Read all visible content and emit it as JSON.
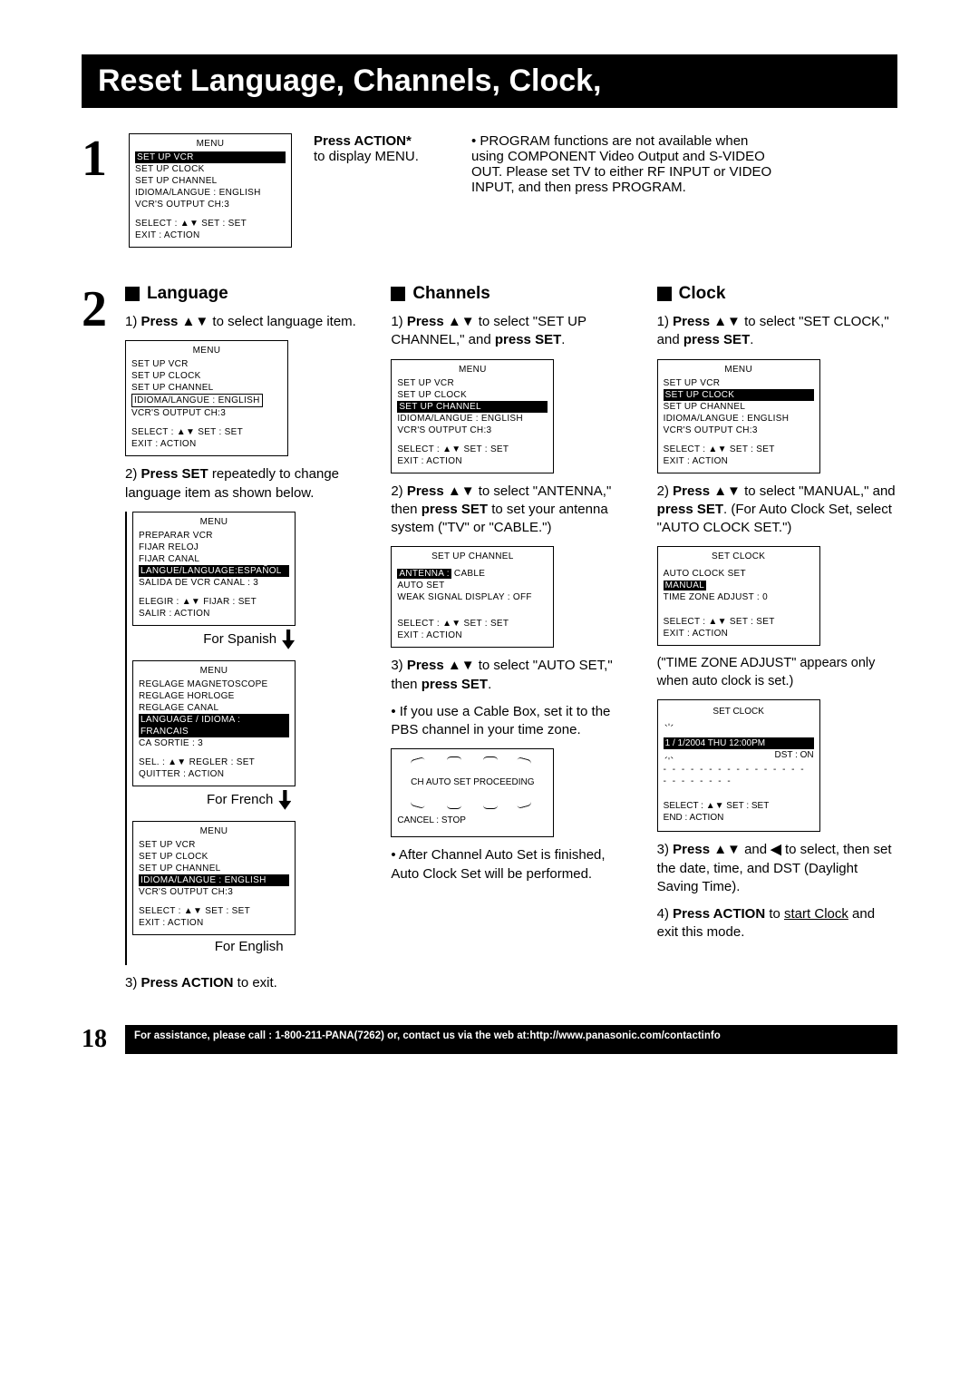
{
  "title_bar": "Reset Language, Channels, Clock,",
  "step1": {
    "num": "1",
    "osd": {
      "title": "MENU",
      "r1": "SET  UP  VCR",
      "r2": "SET  UP  CLOCK",
      "r3": "SET  UP  CHANNEL",
      "r4": "IDIOMA/LANGUE : ENGLISH",
      "r5": "VCR'S  OUTPUT  CH:3",
      "foot1": "SELECT : ▲▼        SET : SET",
      "foot2": "EXIT          : ACTION"
    },
    "mid_bold": "Press ACTION*",
    "mid_plain": "to display MENU.",
    "right": "•  PROGRAM functions are not available when using COMPONENT Video Output and S-VIDEO OUT. Please set TV to either RF INPUT or VIDEO INPUT, and then press PROGRAM."
  },
  "step2_num": "2",
  "lang": {
    "title": "Language",
    "i1a": "1) ",
    "i1b": "Press ▲▼",
    "i1c": " to select language item.",
    "osd1": {
      "title": "MENU",
      "r1": "SET  UP  VCR",
      "r2": "SET  UP  CLOCK",
      "r3": "SET  UP  CHANNEL",
      "r4": "IDIOMA/LANGUE : ENGLISH",
      "r5": "VCR'S  OUTPUT  CH:3",
      "foot1": "SELECT : ▲▼        SET : SET",
      "foot2": "EXIT          : ACTION"
    },
    "i2a": "2) ",
    "i2b": "Press SET",
    "i2c": " repeatedly to change language item as shown below.",
    "osd2": {
      "title": "MENU",
      "r1": "PREPARAR VCR",
      "r2": "FIJAR  RELOJ",
      "r3": "FIJAR  CANAL",
      "r4": "LANGUE/LANGUAGE:ESPAÑOL",
      "r5": "SALIDA  DE  VCR  CANAL : 3",
      "foot1": "ELEGIR  : ▲▼      FIJAR : SET",
      "foot2": "SALIR     : ACTION"
    },
    "cap2": "For  Spanish",
    "osd3": {
      "title": "MENU",
      "r1": "REGLAGE  MAGNETOSCOPE",
      "r2": "REGLAGE  HORLOGE",
      "r3": "REGLAGE  CANAL",
      "r4": "LANGUAGE / IDIOMA : FRANCAIS",
      "r5": "CA  SORTIE : 3",
      "foot1": "SEL.         : ▲▼     REGLER : SET",
      "foot2": "QUITTER : ACTION"
    },
    "cap3": "For  French",
    "osd4": {
      "title": "MENU",
      "r1": "SET  UP  VCR",
      "r2": "SET  UP  CLOCK",
      "r3": "SET  UP  CHANNEL",
      "r4": "IDIOMA/LANGUE : ENGLISH",
      "r5": "VCR'S  OUTPUT  CH:3",
      "foot1": "SELECT : ▲▼        SET : SET",
      "foot2": "EXIT          : ACTION"
    },
    "cap4": "For  English",
    "i3a": "3) ",
    "i3b": "Press ACTION",
    "i3c": " to exit."
  },
  "chan": {
    "title": "Channels",
    "i1a": "1) ",
    "i1b": "Press ▲▼",
    "i1c": " to select \"SET UP CHANNEL,\" and ",
    "i1d": "press SET",
    "i1e": ".",
    "osd1": {
      "title": "MENU",
      "r1": "SET  UP  VCR",
      "r2": "SET  UP  CLOCK",
      "r3": "SET  UP  CHANNEL",
      "r4": "IDIOMA/LANGUE : ENGLISH",
      "r5": "VCR'S  OUTPUT  CH:3",
      "foot1": "SELECT : ▲▼        SET : SET",
      "foot2": "EXIT          : ACTION"
    },
    "i2a": "2) ",
    "i2b": "Press ▲▼",
    "i2c": " to select \"ANTENNA,\" then ",
    "i2d": "press SET",
    "i2e": " to set your antenna system (\"TV\" or \"CABLE.\")",
    "osd2": {
      "title": "SET  UP  CHANNEL",
      "r1a": "ANTENNA   :",
      "r1b": "CABLE",
      "r2": "AUTO  SET",
      "r3": "WEAK  SIGNAL  DISPLAY : OFF",
      "foot1": "SELECT : ▲▼        SET : SET",
      "foot2": "EXIT        : ACTION"
    },
    "i3a": "3) ",
    "i3b": "Press ▲▼",
    "i3c": " to select \"AUTO SET,\" then ",
    "i3d": "press SET",
    "i3e": ".",
    "bul1": "•  If you use a Cable Box, set it to the PBS channel in your time zone.",
    "proc_line": "CH  AUTO  SET  PROCEEDING",
    "proc_foot": "CANCEL : STOP",
    "bul2": "•  After Channel Auto Set is finished, Auto Clock Set will be performed."
  },
  "clock": {
    "title": "Clock",
    "i1a": "1) ",
    "i1b": "Press ▲▼",
    "i1c": " to select \"SET CLOCK,\" and ",
    "i1d": "press SET",
    "i1e": ".",
    "osd1": {
      "title": "MENU",
      "r1": "SET  UP  VCR",
      "r2": "SET  UP  CLOCK",
      "r3": "SET  UP  CHANNEL",
      "r4": "IDIOMA/LANGUE : ENGLISH",
      "r5": "VCR'S  OUTPUT  CH:3",
      "foot1": "SELECT : ▲▼        SET : SET",
      "foot2": "EXIT          : ACTION"
    },
    "i2a": "2) ",
    "i2b": "Press ▲▼",
    "i2c": " to select \"MANUAL,\" and ",
    "i2d": "press SET",
    "i2e": ". (For Auto Clock Set, select \"AUTO CLOCK SET.\")",
    "osd2": {
      "title": "SET  CLOCK",
      "r1": "AUTO  CLOCK  SET",
      "r2": "MANUAL",
      "r3": "TIME  ZONE  ADJUST   :   0",
      "foot1": "SELECT  : ▲▼        SET : SET",
      "foot2": "EXIT        : ACTION"
    },
    "paren": "(\"TIME ZONE ADJUST\" appears only when auto clock is set.)",
    "osd3": {
      "title": "SET  CLOCK",
      "r1": "1 /   1/2004   THU   12:00PM",
      "r2": "DST : ON",
      "dash": "- - - - - - - - - - - - - - - - - - - - - - - -",
      "foot1": "SELECT   : ▲▼       SET : SET",
      "foot2": "END          : ACTION"
    },
    "i3a": "3) ",
    "i3b": "Press ▲▼ ",
    "i3c": "and",
    "i3d": " ◀ ",
    "i3e": "to select, then set the date, time, and DST (Daylight Saving Time).",
    "i4a": "4) ",
    "i4b": "Press ACTION",
    "i4c": " to ",
    "i4d": "start Clock",
    "i4e": " and exit this mode."
  },
  "footer": {
    "page": "18",
    "bar": "For assistance, please call : 1-800-211-PANA(7262) or, contact us via the web at:http://www.panasonic.com/contactinfo"
  }
}
